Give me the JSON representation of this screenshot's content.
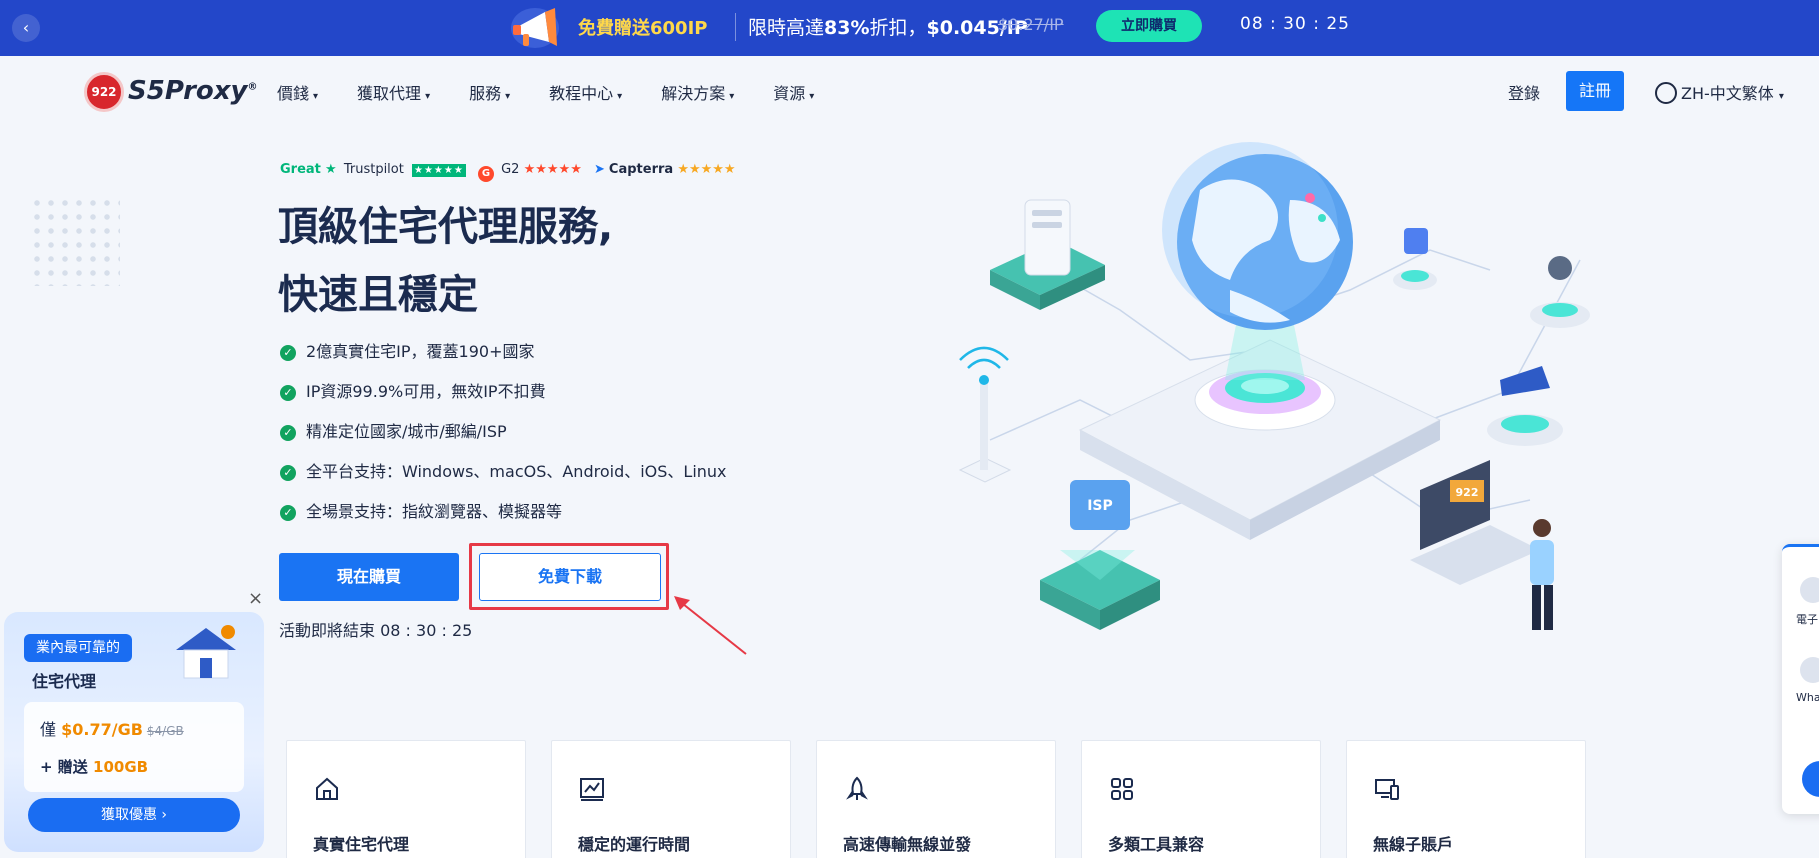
{
  "banner": {
    "gift": "免費贈送600IP",
    "promo_prefix": "限時高達",
    "promo_discount": "83%",
    "promo_mid": "折扣，",
    "promo_price": "$0.045/IP",
    "old_price": "$0.27/IP",
    "buy_label": "立即購買",
    "timer": "08 : 30 : 25"
  },
  "nav": {
    "logo_text": "S5Proxy",
    "logo_badge": "922",
    "items": [
      {
        "label": "價錢"
      },
      {
        "label": "獲取代理"
      },
      {
        "label": "服務"
      },
      {
        "label": "教程中心"
      },
      {
        "label": "解決方案"
      },
      {
        "label": "資源"
      }
    ],
    "login": "登錄",
    "register": "註冊",
    "language": "ZH-中文繁体"
  },
  "ratings": {
    "trustpilot_word": "Great",
    "trustpilot": "Trustpilot",
    "g2": "G2",
    "capterra": "Capterra"
  },
  "hero": {
    "title_line1": "頂級住宅代理服務,",
    "title_line2": "快速且穩定",
    "features": [
      "2億真實住宅IP，覆蓋190+國家",
      "IP資源99.9%可用，無效IP不扣費",
      "精准定位國家/城市/郵編/ISP",
      "全平台支持：Windows、macOS、Android、iOS、Linux",
      "全場景支持：指紋瀏覽器、模擬器等"
    ],
    "buy_button": "現在購買",
    "download_button": "免費下載",
    "countdown_label": "活動即將結束",
    "countdown_time": "08 : 30 : 25"
  },
  "illustration": {
    "isp_label": "ISP",
    "laptop_label": "922"
  },
  "cards": [
    {
      "title": "真實住宅代理",
      "icon": "home-icon"
    },
    {
      "title": "穩定的運行時間",
      "icon": "chart-icon"
    },
    {
      "title": "高速傳輸無線並發",
      "icon": "rocket-icon"
    },
    {
      "title": "多類工具兼容",
      "icon": "grid-icon"
    },
    {
      "title": "無線子賬戶",
      "icon": "devices-icon"
    }
  ],
  "popup": {
    "tag": "業內最可靠的",
    "subtitle": "住宅代理",
    "price_prefix": "僅",
    "price": "$0.77/GB",
    "old_price": "$4/GB",
    "bonus_prefix": "+ 贈送",
    "bonus": "100GB",
    "cta": "獲取優惠 ›",
    "close": "×"
  },
  "side_widget": {
    "email_label": "電子",
    "whatsapp_label": "What"
  },
  "colors": {
    "banner_bg": "#2347c9",
    "accent": "#1a74f3",
    "highlight_border": "#e63946",
    "check_green": "#11a35f"
  }
}
